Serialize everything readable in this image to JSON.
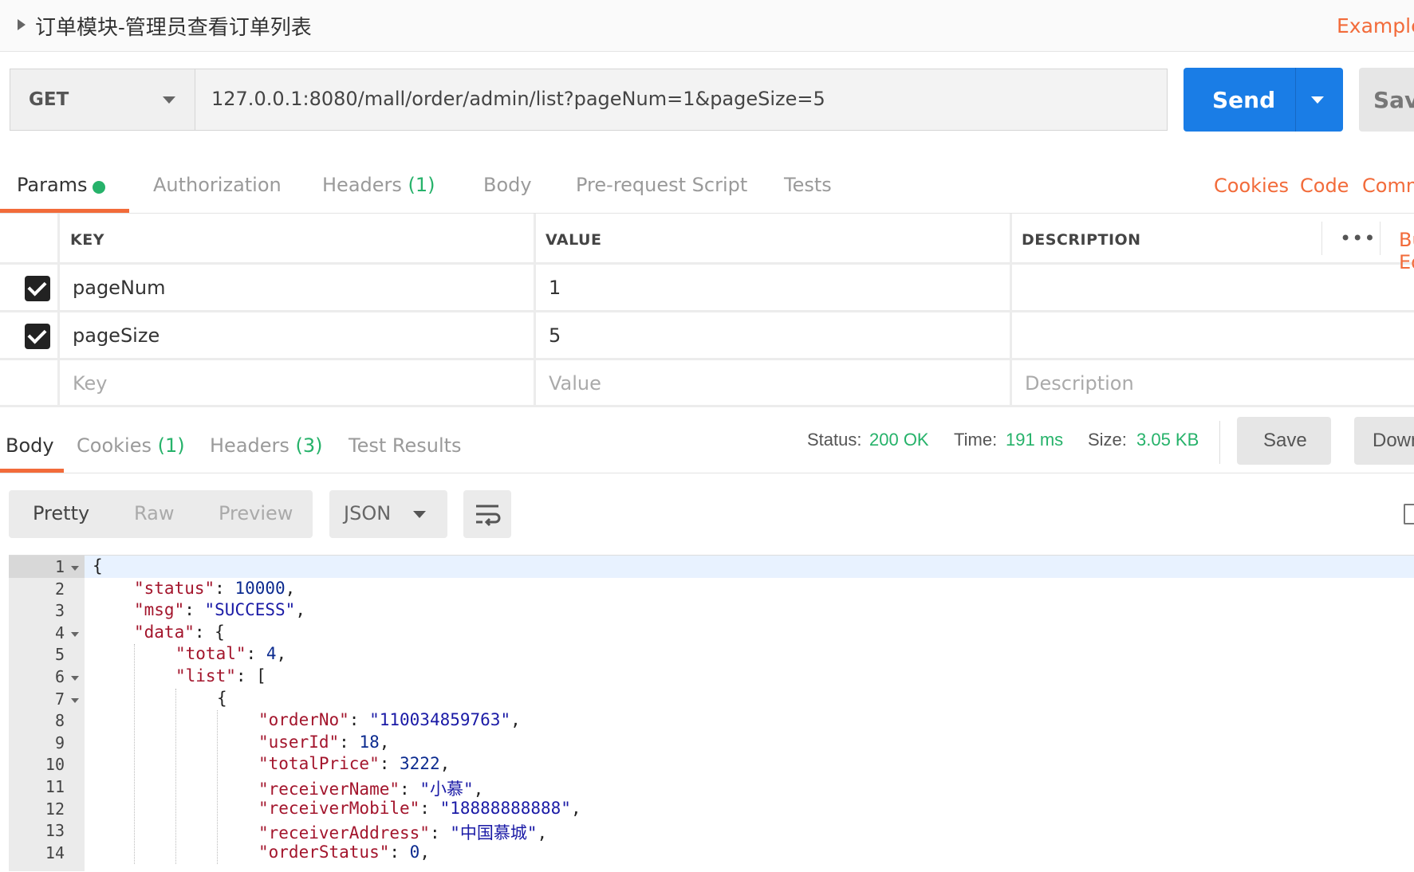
{
  "title": "订单模块-管理员查看订单列表",
  "examples_link": "Examples",
  "request": {
    "method": "GET",
    "url": "127.0.0.1:8080/mall/order/admin/list?pageNum=1&pageSize=5",
    "send_label": "Send",
    "save_label": "Save"
  },
  "request_tabs": {
    "params": "Params",
    "authorization": "Authorization",
    "headers": "Headers",
    "headers_count": "(1)",
    "body": "Body",
    "prerequest": "Pre-request Script",
    "tests": "Tests"
  },
  "request_links": {
    "cookies": "Cookies",
    "code": "Code",
    "comments": "Comments"
  },
  "params_table": {
    "headers": {
      "key": "KEY",
      "value": "VALUE",
      "description": "DESCRIPTION"
    },
    "more": "•••",
    "bulk_edit": "Bulk Edit",
    "rows": [
      {
        "key": "pageNum",
        "value": "1",
        "checked": true
      },
      {
        "key": "pageSize",
        "value": "5",
        "checked": true
      }
    ],
    "placeholders": {
      "key": "Key",
      "value": "Value",
      "description": "Description"
    }
  },
  "response_tabs": {
    "body": "Body",
    "cookies": "Cookies",
    "cookies_count": "(1)",
    "headers": "Headers",
    "headers_count": "(3)",
    "test_results": "Test Results"
  },
  "response_meta": {
    "status_label": "Status:",
    "status_value": "200 OK",
    "time_label": "Time:",
    "time_value": "191 ms",
    "size_label": "Size:",
    "size_value": "3.05 KB",
    "save_label": "Save",
    "download_label": "Download"
  },
  "view_options": {
    "pretty": "Pretty",
    "raw": "Raw",
    "preview": "Preview",
    "format": "JSON"
  },
  "code_lines": [
    {
      "n": "1",
      "fold": true
    },
    {
      "n": "2",
      "key": "\"status\"",
      "value": "10000",
      "type": "number",
      "tail": ","
    },
    {
      "n": "3",
      "key": "\"msg\"",
      "value": "\"SUCCESS\"",
      "type": "string",
      "tail": ","
    },
    {
      "n": "4",
      "fold": true,
      "key": "\"data\"",
      "open": "{"
    },
    {
      "n": "5",
      "key": "\"total\"",
      "value": "4",
      "type": "number",
      "tail": ","
    },
    {
      "n": "6",
      "fold": true,
      "key": "\"list\"",
      "open": "["
    },
    {
      "n": "7",
      "fold": true,
      "open": "{"
    },
    {
      "n": "8",
      "key": "\"orderNo\"",
      "value": "\"110034859763\"",
      "type": "string",
      "tail": ","
    },
    {
      "n": "9",
      "key": "\"userId\"",
      "value": "18",
      "type": "number",
      "tail": ","
    },
    {
      "n": "10",
      "key": "\"totalPrice\"",
      "value": "3222",
      "type": "number",
      "tail": ","
    },
    {
      "n": "11",
      "key": "\"receiverName\"",
      "value": "\"小慕\"",
      "type": "string",
      "tail": ","
    },
    {
      "n": "12",
      "key": "\"receiverMobile\"",
      "value": "\"18888888888\"",
      "type": "string",
      "tail": ","
    },
    {
      "n": "13",
      "key": "\"receiverAddress\"",
      "value": "\"中国慕城\"",
      "type": "string",
      "tail": ","
    },
    {
      "n": "14",
      "key": "\"orderStatus\"",
      "value": "0",
      "type": "number",
      "tail": ","
    }
  ]
}
